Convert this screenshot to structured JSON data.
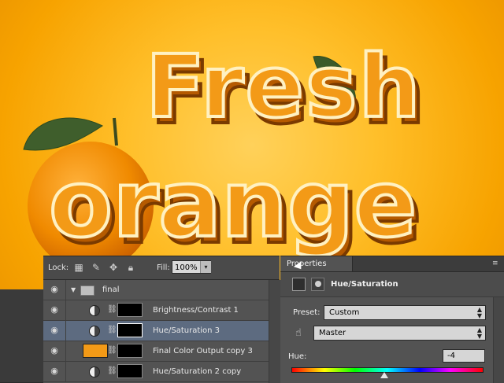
{
  "artwork": {
    "line1": "Fresh",
    "line2": "orange",
    "background_color": "#f7a300",
    "letter_color": "#f08a00",
    "rim_color": "#fff1c2"
  },
  "layers_panel": {
    "lock_label": "Lock:",
    "fill_label": "Fill:",
    "fill_value": "100%",
    "group": {
      "name": "final"
    },
    "layers": [
      {
        "name": "Brightness/Contrast 1",
        "type": "adjustment",
        "selected": false
      },
      {
        "name": "Hue/Saturation 3",
        "type": "adjustment",
        "selected": true
      },
      {
        "name": "Final Color Output copy 3",
        "type": "pixel",
        "selected": false
      },
      {
        "name": "Hue/Saturation 2 copy",
        "type": "adjustment",
        "selected": false
      }
    ]
  },
  "properties_panel": {
    "tab_label": "Properties",
    "title": "Hue/Saturation",
    "preset_label": "Preset:",
    "preset_value": "Custom",
    "channel_value": "Master",
    "hue_label": "Hue:",
    "hue_value": "-4",
    "hue_range": [
      -180,
      180
    ]
  }
}
